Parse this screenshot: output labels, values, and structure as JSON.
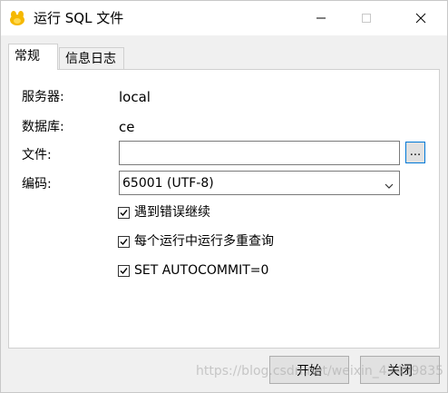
{
  "window": {
    "title": "运行 SQL 文件"
  },
  "tabs": [
    {
      "label": "常规",
      "active": true
    },
    {
      "label": "信息日志",
      "active": false
    }
  ],
  "form": {
    "server_label": "服务器:",
    "server_value": "local",
    "database_label": "数据库:",
    "database_value": "ce",
    "file_label": "文件:",
    "file_value": "",
    "browse_label": "...",
    "encoding_label": "编码:",
    "encoding_value": "65001 (UTF-8)"
  },
  "options": [
    {
      "label": "遇到错误继续",
      "checked": true
    },
    {
      "label": "每个运行中运行多重查询",
      "checked": true
    },
    {
      "label": "SET AUTOCOMMIT=0",
      "checked": true
    }
  ],
  "buttons": {
    "start": "开始",
    "close": "关闭"
  },
  "watermark": "https://blog.csdn.net/weixin_43459835",
  "colors": {
    "accent": "#0078d7",
    "background": "#f0f0f0",
    "panel": "#ffffff"
  },
  "icons": {
    "app": "navicat-app-icon",
    "minimize": "minimize-icon",
    "maximize": "maximize-icon",
    "close": "close-icon",
    "dropdown": "chevron-down-icon",
    "check": "checkmark-icon"
  }
}
